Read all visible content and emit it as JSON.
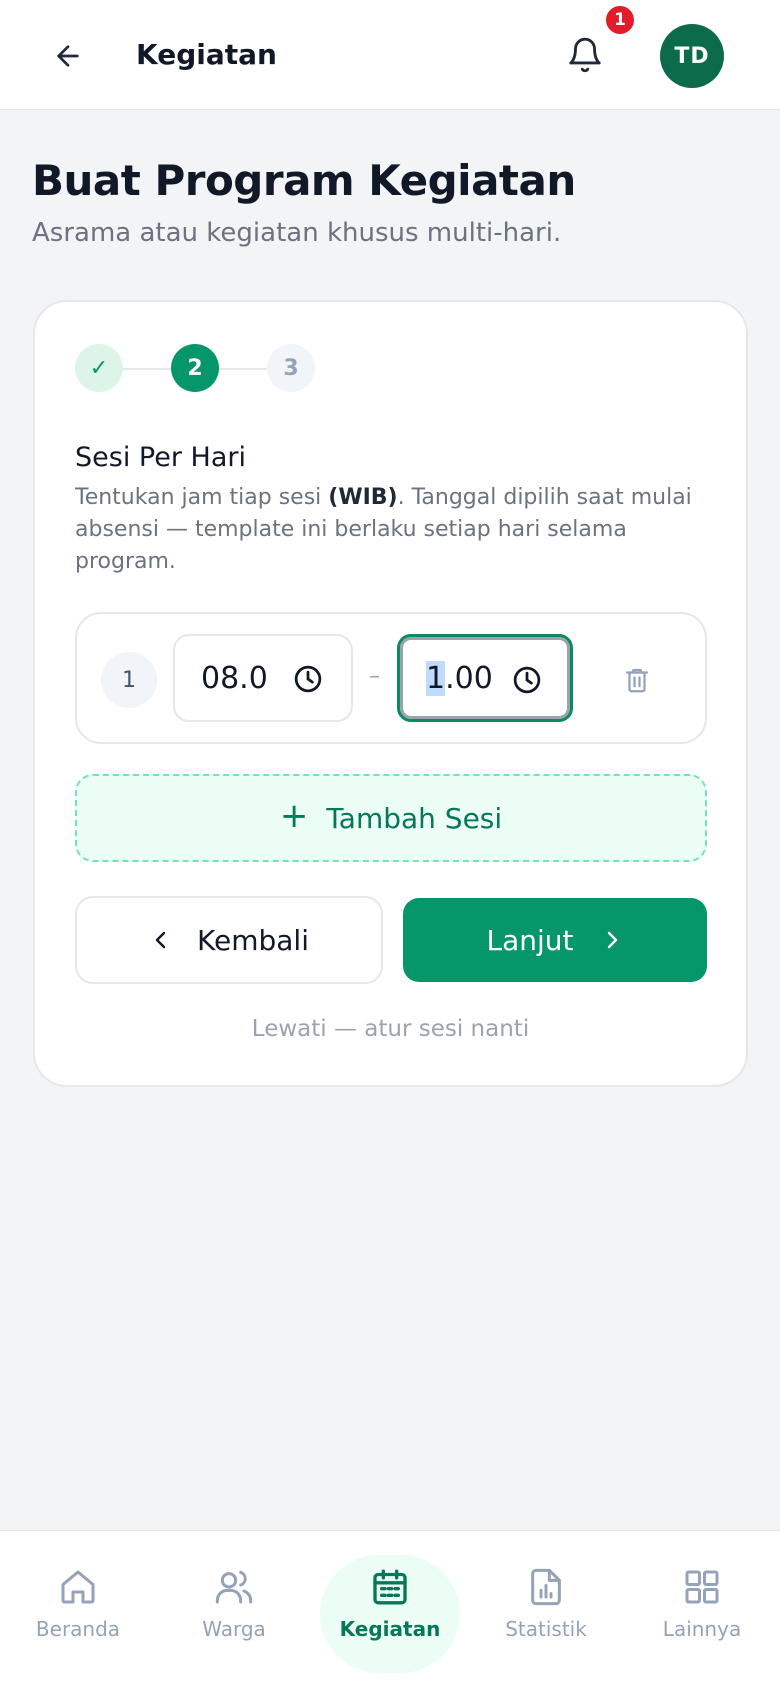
{
  "header": {
    "title": "Kegiatan",
    "notification_count": "1",
    "avatar_initials": "TD"
  },
  "page": {
    "title": "Buat Program Kegiatan",
    "subtitle": "Asrama atau kegiatan khusus multi-hari."
  },
  "stepper": {
    "steps": [
      {
        "label": "✓",
        "state": "done"
      },
      {
        "label": "2",
        "state": "active"
      },
      {
        "label": "3",
        "state": "todo"
      }
    ]
  },
  "section": {
    "title": "Sesi Per Hari",
    "desc_before": "Tentukan jam tiap sesi ",
    "desc_bold": "(WIB)",
    "desc_after": ". Tanggal dipilih saat mulai absensi — template ini berlaku setiap hari selama program."
  },
  "sessions": [
    {
      "number": "1",
      "start_value": "08.0",
      "end_value_selected": "1",
      "end_value_rest": ".00",
      "separator": "–"
    }
  ],
  "actions": {
    "add_session_label": "Tambah Sesi",
    "back_label": "Kembali",
    "next_label": "Lanjut",
    "skip_label": "Lewati — atur sesi nanti"
  },
  "nav": {
    "items": [
      {
        "label": "Beranda",
        "icon": "home-icon"
      },
      {
        "label": "Warga",
        "icon": "users-icon"
      },
      {
        "label": "Kegiatan",
        "icon": "calendar-icon",
        "active": true
      },
      {
        "label": "Statistik",
        "icon": "chart-file-icon"
      },
      {
        "label": "Lainnya",
        "icon": "grid-icon"
      }
    ]
  },
  "colors": {
    "primary": "#059669",
    "primary_dark": "#0b6b4b",
    "badge": "#e11d2a"
  }
}
